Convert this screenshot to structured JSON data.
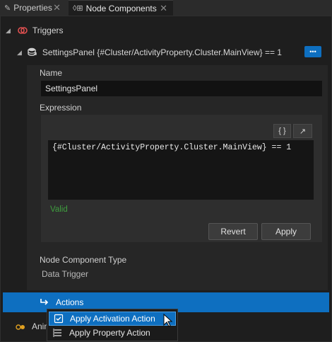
{
  "tabs": [
    {
      "label": "Properties",
      "icon": "wrench-icon"
    },
    {
      "label": "Node Components",
      "icon": "node-components-icon"
    }
  ],
  "triggers_header": "Triggers",
  "trigger": {
    "title": "SettingsPanel {#Cluster/ActivityProperty.Cluster.MainView} == 1",
    "more_button": "•••"
  },
  "name": {
    "label": "Name",
    "value": "SettingsPanel"
  },
  "expression": {
    "label": "Expression",
    "braces_button": "{ }",
    "expand_button": "↗",
    "code": "{#Cluster/ActivityProperty.Cluster.MainView} == 1",
    "status": "Valid",
    "revert_label": "Revert",
    "apply_label": "Apply"
  },
  "node_component_type": {
    "label": "Node Component Type",
    "value": "Data Trigger"
  },
  "actions": {
    "label": "Actions"
  },
  "animations_partial": "Anim",
  "context_menu": [
    {
      "label": "Apply Activation Action",
      "selected": true
    },
    {
      "label": "Apply Property Action",
      "selected": false
    }
  ],
  "colors": {
    "accent": "#0e6fc0",
    "valid": "#3f9e3f",
    "background": "#1e1e1e",
    "trigger_icon": "#e05050"
  }
}
